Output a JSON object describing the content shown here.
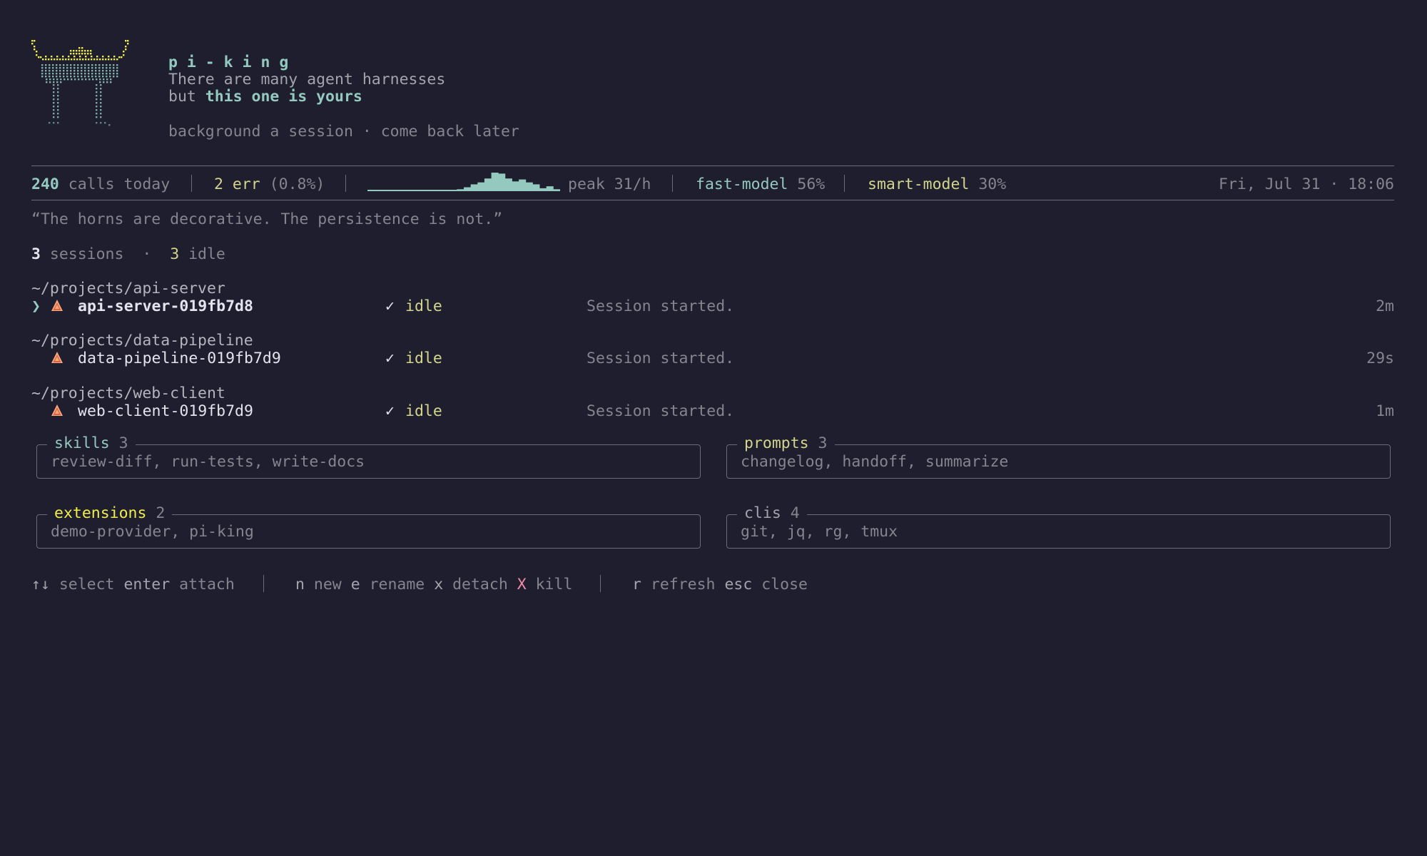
{
  "header": {
    "app_name": "p i - k i n g",
    "tagline_line1": "There are many agent harnesses",
    "tagline_but": "but ",
    "tagline_emph": "this one is yours",
    "hint": "background a session · come back later"
  },
  "stats": {
    "calls_count": "240",
    "calls_label": " calls today",
    "err_count": "2 err",
    "err_pct": " (0.8%)",
    "sparkline_values": [
      1,
      1,
      1,
      1,
      1,
      1,
      1,
      1,
      1,
      1,
      1,
      1,
      1,
      2,
      4,
      7,
      9,
      13,
      19,
      18,
      13,
      10,
      12,
      9,
      7,
      3,
      5,
      2
    ],
    "peak": "peak 31/h",
    "fast_model_name": "fast-model",
    "fast_model_pct": " 56%",
    "smart_model_name": "smart-model",
    "smart_model_pct": " 30%",
    "datetime": "Fri, Jul 31 · 18:06"
  },
  "quote": "“The horns are decorative. The persistence is not.”",
  "summary": {
    "sessions_count": "3",
    "sessions_label": " sessions",
    "separator": "·",
    "idle_count": "3",
    "idle_label": " idle"
  },
  "sessions": [
    {
      "path": "~/projects/api-server",
      "cursor": "❯",
      "name": "api-server-019fb7d8",
      "status_icon": "✓",
      "status": "idle",
      "message": "Session started.",
      "age": "2m",
      "selected": true
    },
    {
      "path": "~/projects/data-pipeline",
      "cursor": "",
      "name": "data-pipeline-019fb7d9",
      "status_icon": "✓",
      "status": "idle",
      "message": "Session started.",
      "age": "29s",
      "selected": false
    },
    {
      "path": "~/projects/web-client",
      "cursor": "",
      "name": "web-client-019fb7d9",
      "status_icon": "✓",
      "status": "idle",
      "message": "Session started.",
      "age": "1m",
      "selected": false
    }
  ],
  "panels": {
    "skills": {
      "title": "skills",
      "count": " 3",
      "items": "review-diff, run-tests, write-docs"
    },
    "prompts": {
      "title": "prompts",
      "count": " 3",
      "items": "changelog, handoff, summarize"
    },
    "extensions": {
      "title": "extensions",
      "count": " 2",
      "items": "demo-provider, pi-king"
    },
    "clis": {
      "title": "clis",
      "count": " 4",
      "items": "git, jq, rg, tmux"
    }
  },
  "keybinds": {
    "nav_key": "↑↓",
    "nav_label": " select ",
    "enter_key": "enter",
    "enter_label": " attach",
    "new_key": "n",
    "new_label": " new ",
    "rename_key": "e",
    "rename_label": " rename ",
    "detach_key": "x",
    "detach_label": " detach ",
    "kill_key": "X",
    "kill_label": " kill",
    "refresh_key": "r",
    "refresh_label": " refresh ",
    "close_key": "esc",
    "close_label": " close"
  },
  "colors": {
    "background": "#1e1e2e",
    "teal": "#94c9c0",
    "yellow": "#d3d58c",
    "bright_yellow": "#f0ed4a",
    "red": "#f38ba8"
  }
}
